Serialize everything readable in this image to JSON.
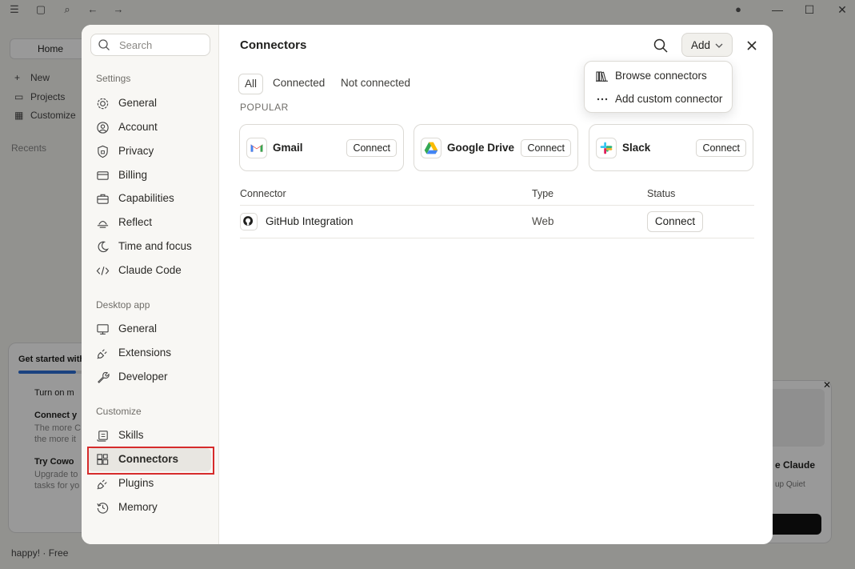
{
  "background_app": {
    "home_label": "Home",
    "nav": [
      "New",
      "Projects",
      "Customize"
    ],
    "recents_label": "Recents",
    "card_title": "Get started with",
    "card_rows": [
      "Turn on m",
      "Connect y",
      "The more C",
      "the more it",
      "Try Cowo",
      "Upgrade to",
      "tasks for yo"
    ],
    "right_card_title": "e Claude",
    "right_card_sub": "up Quiet",
    "user_label": "happy! · Free"
  },
  "sidebar": {
    "search_placeholder": "Search",
    "sections": {
      "settings": "Settings",
      "desktop_app": "Desktop app",
      "customize": "Customize"
    },
    "settings_items": [
      "General",
      "Account",
      "Privacy",
      "Billing",
      "Capabilities",
      "Reflect",
      "Time and focus",
      "Claude Code"
    ],
    "desktop_items": [
      "General",
      "Extensions",
      "Developer"
    ],
    "customize_items": [
      "Skills",
      "Connectors",
      "Plugins",
      "Memory"
    ]
  },
  "main": {
    "title": "Connectors",
    "add_label": "Add",
    "tabs": [
      "All",
      "Connected",
      "Not connected"
    ],
    "popular_label": "POPULAR",
    "popular_cards": [
      {
        "name": "Gmail",
        "button": "Connect"
      },
      {
        "name": "Google Drive",
        "button": "Connect"
      },
      {
        "name": "Slack",
        "button": "Connect"
      }
    ],
    "table": {
      "headers": [
        "Connector",
        "Type",
        "Status"
      ],
      "rows": [
        {
          "name": "GitHub Integration",
          "type": "Web",
          "status_button": "Connect"
        }
      ]
    }
  },
  "dropdown": {
    "items": [
      "Browse connectors",
      "Add custom connector"
    ]
  },
  "colors": {
    "highlight": "#d62b2b",
    "gmail_red": "#ea4335",
    "drive_green": "#34a853",
    "drive_yellow": "#fbbc04",
    "drive_blue": "#4285f4"
  }
}
